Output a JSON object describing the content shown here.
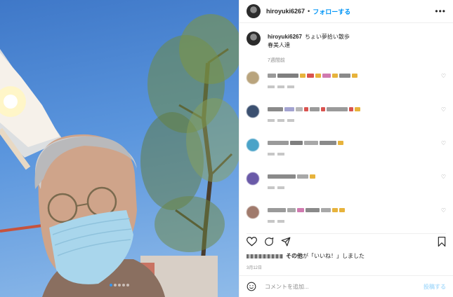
{
  "post": {
    "username": "hiroyuki6267",
    "separator": "•",
    "follow_label": "フォローする",
    "more_icon": "more-horizontal-icon",
    "caption_line1": "ちょい夢拾い散歩",
    "caption_line2": "春美人達",
    "caption_time": "7週間前",
    "liked_by_suffix": "その他",
    "liked_by_text": "が「いいね！」しました",
    "date": "3月12日",
    "comment_placeholder": "コメントを追加...",
    "post_label": "投稿する"
  },
  "comments": [
    {
      "avatar_color": "#b9a47d"
    },
    {
      "avatar_color": "#3b5070"
    },
    {
      "avatar_color": "#4aa3c8"
    },
    {
      "avatar_color": "#6a5aa8"
    },
    {
      "avatar_color": "#a07a6c"
    }
  ],
  "carousel": {
    "count": 5,
    "active": 1
  },
  "colors": {
    "accent": "#0095f6",
    "text": "#262626",
    "muted": "#8e8e8e"
  }
}
